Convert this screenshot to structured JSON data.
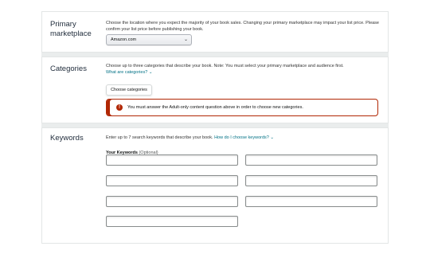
{
  "marketplace": {
    "title": "Primary\nmarketplace",
    "description": "Choose the location where you expect the majority of your book sales. Changing your primary marketplace may impact your list price. Please confirm your list price before publishing your book.",
    "selected": "Amazon.com"
  },
  "categories": {
    "title": "Categories",
    "description": "Choose up to three categories that describe your book. Note: You must select your primary marketplace and audience first.",
    "help_link": "What are categories?",
    "button_label": "Choose categories",
    "error_message": "You must answer the Adult-only content question above in order to choose new categories."
  },
  "keywords": {
    "title": "Keywords",
    "description": "Enter up to 7 search keywords that describe your book.",
    "help_link": "How do I choose keywords?",
    "field_label": "Your Keywords",
    "field_label_optional": "(Optional)",
    "inputs": [
      "",
      "",
      "",
      "",
      "",
      "",
      ""
    ]
  },
  "icons": {
    "chevron": "chevron-down-icon",
    "alert": "alert-circle-icon"
  },
  "colors": {
    "error": "#b12704",
    "link": "#007185",
    "divider": "#eaeded"
  }
}
